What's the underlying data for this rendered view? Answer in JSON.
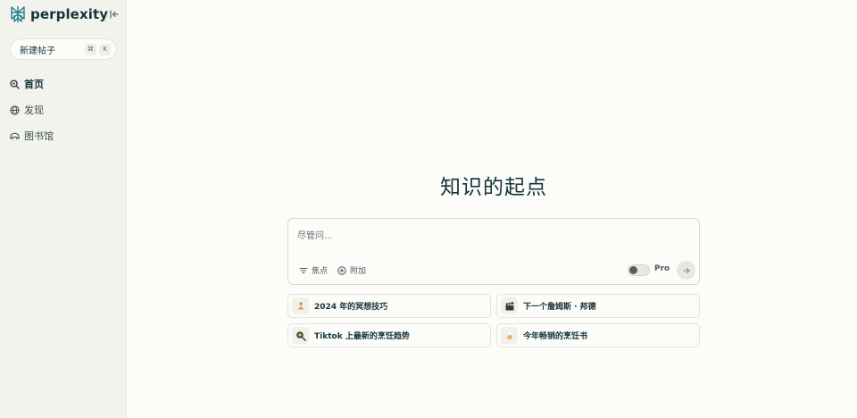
{
  "sidebar": {
    "brand": "perplexity",
    "new_thread": {
      "label": "新建帖子",
      "shortcut_keys": [
        "⌘",
        "K"
      ]
    },
    "nav": [
      {
        "label": "首页",
        "icon": "search-icon",
        "active": true
      },
      {
        "label": "发现",
        "icon": "globe-icon",
        "active": false
      },
      {
        "label": "图书馆",
        "icon": "library-icon",
        "active": false
      }
    ]
  },
  "main": {
    "headline": "知识的起点",
    "ask": {
      "placeholder": "尽管问...",
      "value": "",
      "focus_label": "焦点",
      "attach_label": "附加",
      "pro_label": "Pro",
      "pro_enabled": false
    },
    "suggestions": [
      {
        "label": "2024 年的冥想技巧",
        "icon": "meditation-icon"
      },
      {
        "label": "下一个詹姆斯 · 邦德",
        "icon": "clapperboard-icon"
      },
      {
        "label": "Tiktok 上最新的烹饪趋势",
        "icon": "frying-pan-icon"
      },
      {
        "label": "今年畅销的烹饪书",
        "icon": "chef-icon"
      }
    ]
  },
  "colors": {
    "background": "#fcfcf9",
    "sidebar": "#f3f3ee",
    "brand_teal": "#20808d",
    "text": "#13343b"
  }
}
